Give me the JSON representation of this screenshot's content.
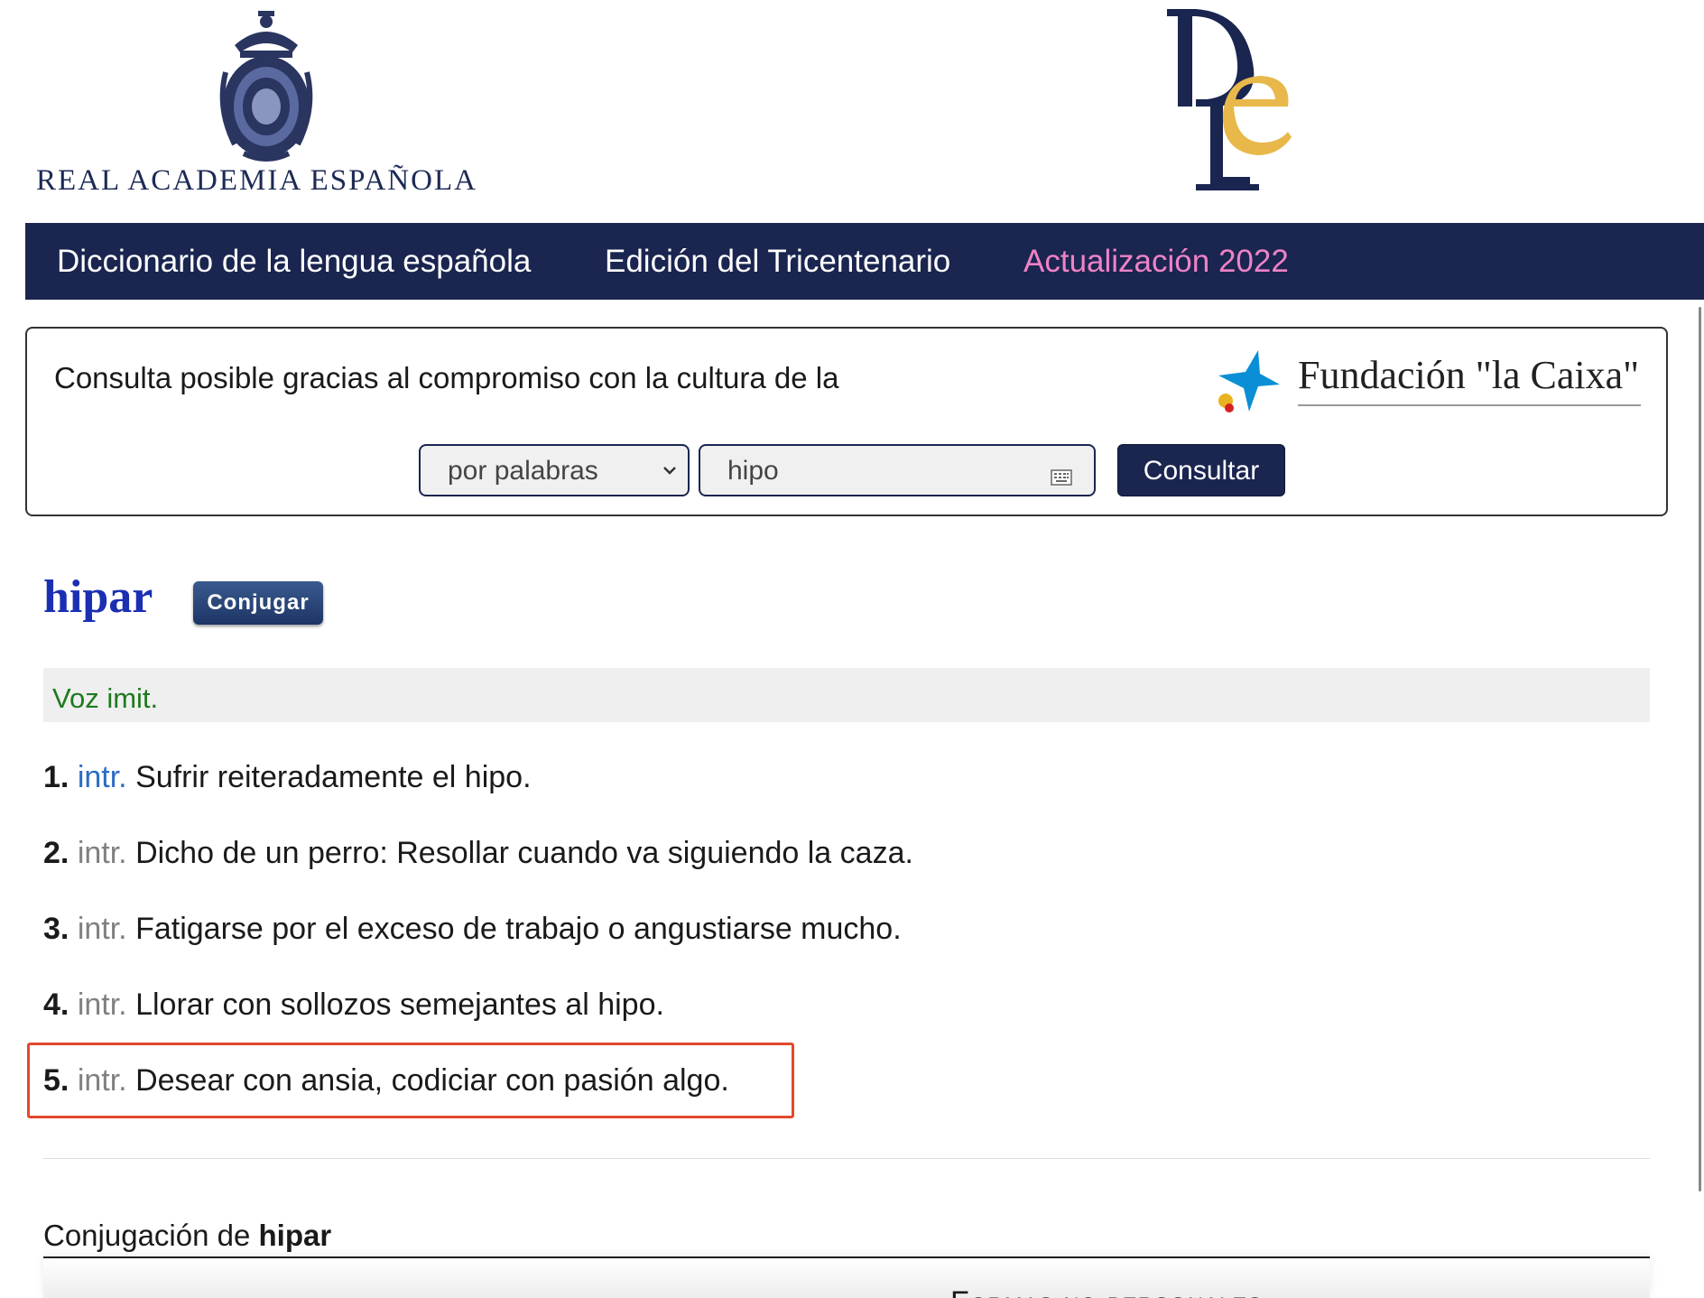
{
  "header": {
    "rae_name": "REAL ACADEMIA ESPAÑOLA"
  },
  "nav": {
    "items": [
      {
        "label": "Diccionario de la lengua española"
      },
      {
        "label": "Edición del Tricentenario"
      },
      {
        "label": "Actualización 2022"
      }
    ]
  },
  "search": {
    "sponsor_text": "Consulta posible gracias al compromiso con la cultura de la",
    "sponsor_name": "Fundación \"la Caixa\"",
    "mode_selected": "por palabras",
    "query_value": "hipo",
    "submit_label": "Consultar"
  },
  "entry": {
    "headword": "hipar",
    "conjugate_label": "Conjugar",
    "etymology": "Voz imit.",
    "senses": [
      {
        "num": "1.",
        "abbr": "intr.",
        "text": "Sufrir reiteradamente el hipo."
      },
      {
        "num": "2.",
        "abbr": "intr.",
        "text": "Dicho de un perro: Resollar cuando va siguiendo la caza."
      },
      {
        "num": "3.",
        "abbr": "intr.",
        "text": "Fatigarse por el exceso de trabajo o angustiarse mucho."
      },
      {
        "num": "4.",
        "abbr": "intr.",
        "text": "Llorar con sollozos semejantes al hipo."
      },
      {
        "num": "5.",
        "abbr": "intr.",
        "text": "Desear con ansia, codiciar con pasión algo."
      }
    ]
  },
  "conjugation": {
    "title_prefix": "Conjugación de",
    "verb": "hipar",
    "table_header": "Formas no personales"
  },
  "colors": {
    "navy": "#1a2550",
    "nav_highlight": "#ee82c6",
    "headword": "#1b2fb3",
    "etymology": "#1e7a1e",
    "abbr_link": "#2b6cc4",
    "highlight_border": "#e2492c"
  }
}
